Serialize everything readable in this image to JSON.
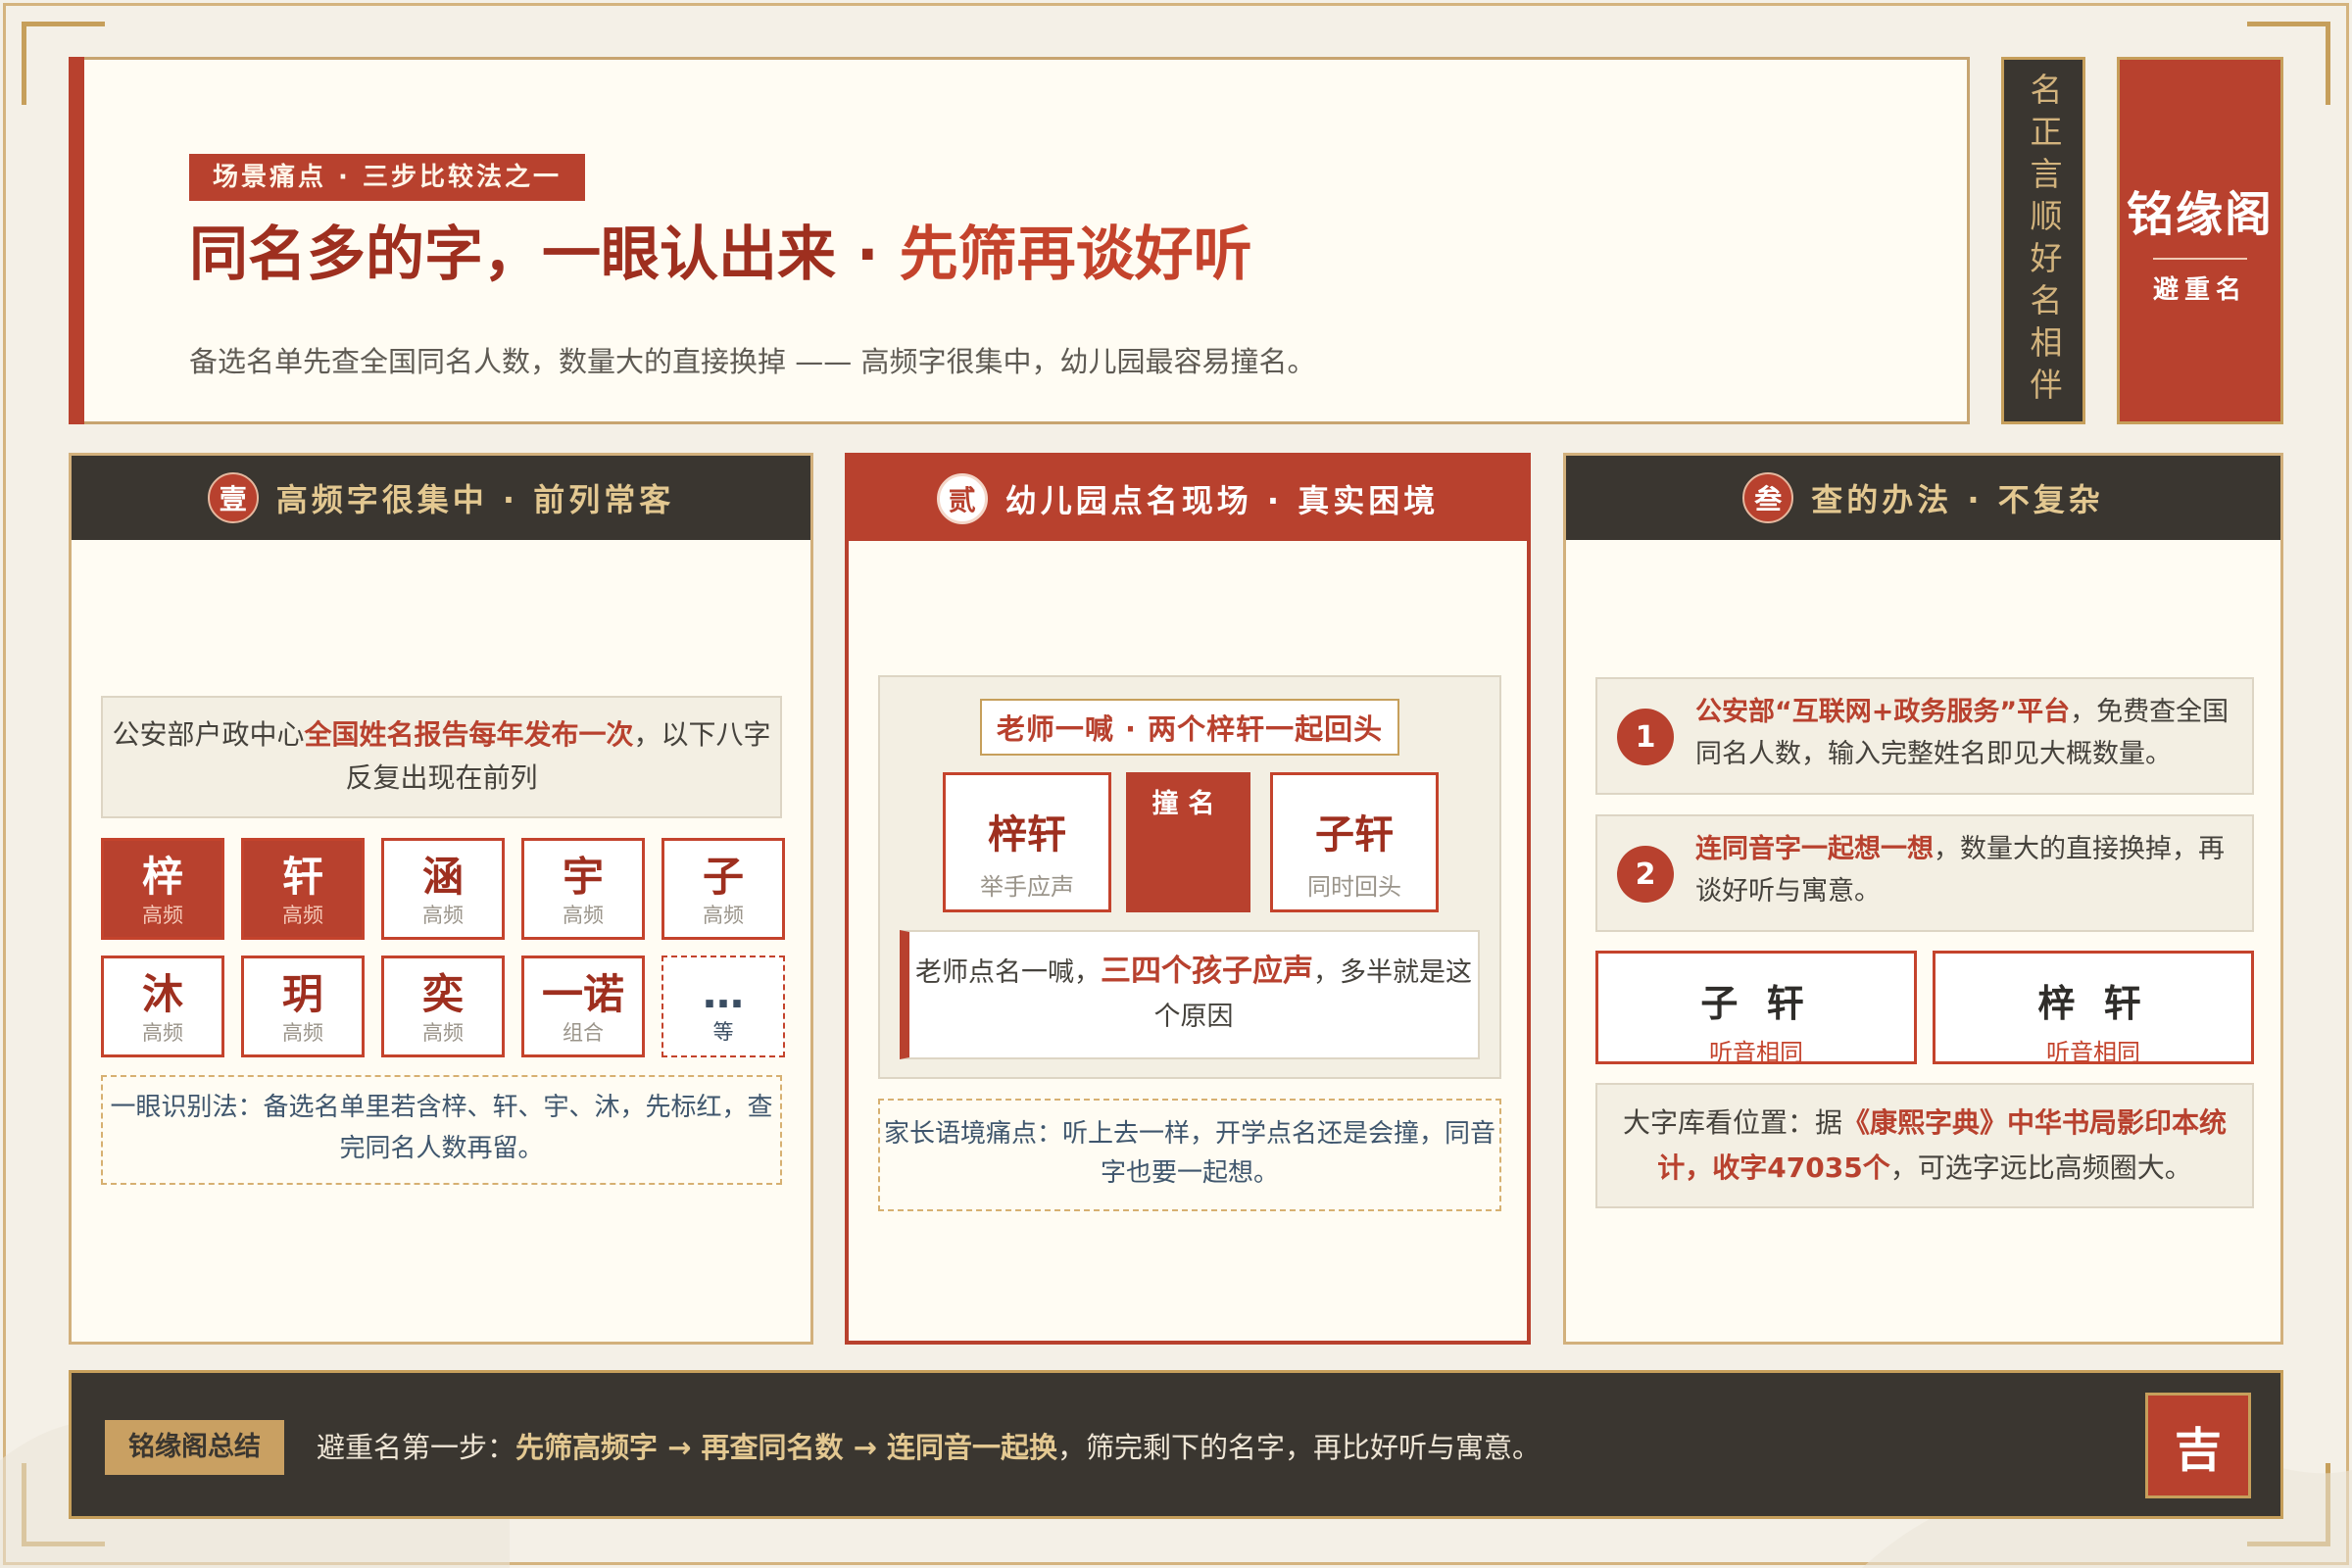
{
  "header": {
    "tag": "场景痛点 · 三步比较法之一",
    "title_main": "同名多的字，一眼认出来 · ",
    "title_highlight": "先筛再谈好听",
    "subtitle": "备选名单先查全国同名人数，数量大的直接换掉 —— 高频字很集中，幼儿园最容易撞名。"
  },
  "side": {
    "vertical_text": "名正言顺好名相伴",
    "brand": "铭缘阁",
    "brand_sub": "避重名"
  },
  "panel1": {
    "num": "壹",
    "title": "高频字很集中 · 前列常客",
    "intro_pre": "公安部户政中心",
    "intro_hl": "全国姓名报告每年发布一次",
    "intro_post": "，以下八字反复出现在前列",
    "chips": [
      {
        "char": "梓",
        "label": "高频"
      },
      {
        "char": "轩",
        "label": "高频"
      },
      {
        "char": "涵",
        "label": "高频"
      },
      {
        "char": "宇",
        "label": "高频"
      },
      {
        "char": "子",
        "label": "高频"
      },
      {
        "char": "沐",
        "label": "高频"
      },
      {
        "char": "玥",
        "label": "高频"
      },
      {
        "char": "奕",
        "label": "高频"
      },
      {
        "char": "一诺",
        "label": "组合"
      },
      {
        "char": "…",
        "label": "等"
      }
    ],
    "tip": "一眼识别法：备选名单里若含梓、轩、宇、沐，先标红，查完同名人数再留。"
  },
  "panel2": {
    "num": "贰",
    "title": "幼儿园点名现场 · 真实困境",
    "scene_title": "老师一喊 · 两个梓轩一起回头",
    "name_a": "梓轩",
    "name_a_sub": "举手应声",
    "collide": "撞名",
    "name_b": "子轩",
    "name_b_sub": "同时回头",
    "callout_pre": "老师点名一喊，",
    "callout_hl": "三四个孩子应声",
    "callout_post": "，多半就是这个原因",
    "note": "家长语境痛点：听上去一样，开学点名还是会撞，同音字也要一起想。"
  },
  "panel3": {
    "num": "叁",
    "title": "查的办法 · 不复杂",
    "step1_num": "1",
    "step1_hl": "公安部“互联网+政务服务”平台",
    "step1_text": "，免费查全国同名人数，输入完整姓名即见大概数量。",
    "step2_num": "2",
    "step2_hl": "连同音字一起想一想",
    "step2_text": "，数量大的直接换掉，再谈好听与寓意。",
    "box1_name": "子 轩",
    "box1_sub": "听音相同",
    "box2_name": "梓 轩",
    "box2_sub": "听音相同",
    "dict_pre": "大字库看位置：据",
    "dict_hl": "《康熙字典》中华书局影印本统计，收字47035个",
    "dict_post": "，可选字远比高频圈大。"
  },
  "footer": {
    "label": "铭缘阁总结",
    "text_pre": "避重名第一步：",
    "text_hl": "先筛高频字 → 再查同名数 → 连同音一起换",
    "text_post": "，筛完剩下的名字，再比好听与寓意。",
    "seal": "吉"
  }
}
